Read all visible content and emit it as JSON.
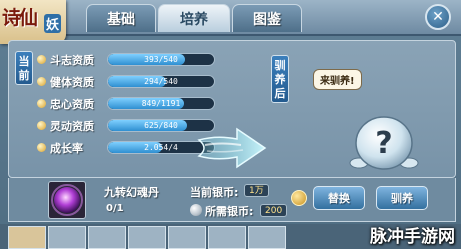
{
  "header": {
    "logo": "诗仙",
    "logo_sub": "妖",
    "tabs": [
      {
        "label": "基础",
        "active": false
      },
      {
        "label": "培养",
        "active": true
      },
      {
        "label": "图鉴",
        "active": false
      }
    ],
    "close_icon": "close-icon"
  },
  "left_panel": {
    "label": "当前",
    "attributes": [
      {
        "label": "斗志资质",
        "value": "393/540",
        "fraction": 0.728
      },
      {
        "label": "健体资质",
        "value": "294/540",
        "fraction": 0.544
      },
      {
        "label": "忠心资质",
        "value": "849/1191",
        "fraction": 0.713
      },
      {
        "label": "灵动资质",
        "value": "625/840",
        "fraction": 0.744
      },
      {
        "label": "成长率",
        "value": "2.054/4",
        "fraction": 0.514
      }
    ]
  },
  "right_panel": {
    "label": "驯养后",
    "bubble": "来驯养!"
  },
  "bottom": {
    "item_name": "九转幻魂丹",
    "item_count": "0/1",
    "current_coin_label": "当前银币:",
    "current_coin_value": "1万",
    "required_coin_label": "所需银币:",
    "required_coin_value": "200",
    "replace_button": "替换",
    "tame_button": "驯养"
  },
  "watermark": "脉冲手游网",
  "colors": {
    "accent": "#2f8fd1",
    "tab_active": "#eef4f8",
    "coin": "#ffe28a"
  }
}
